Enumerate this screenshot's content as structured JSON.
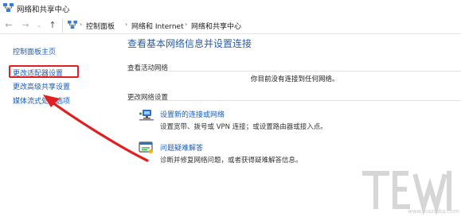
{
  "window": {
    "title": "网络和共享中心"
  },
  "nav": {
    "back_icon": "back-arrow-icon",
    "forward_icon": "forward-arrow-icon",
    "history_icon": "chevron-down-icon",
    "up_icon": "up-arrow-icon",
    "breadcrumbs": [
      "控制面板",
      "网络和 Internet",
      "网络和共享中心"
    ],
    "separator": "›"
  },
  "sidebar": {
    "items": [
      {
        "label": "控制面板主页"
      },
      {
        "label": "更改适配器设置",
        "highlighted": true
      },
      {
        "label": "更改高级共享设置"
      },
      {
        "label": "媒体流式处理选项"
      }
    ]
  },
  "main": {
    "heading": "查看基本网络信息并设置连接",
    "active_networks_label": "查看活动网络",
    "no_network_text": "你目前没有连接到任何网络。",
    "change_settings_label": "更改网络设置",
    "actions": [
      {
        "icon": "network-setup-icon",
        "title": "设置新的连接或网络",
        "description": "设置宽带、拨号或 VPN 连接；或设置路由器或接入点。"
      },
      {
        "icon": "troubleshoot-icon",
        "title": "问题疑难解答",
        "description": "诊断并修复网络问题，或者获得疑难解答信息。"
      }
    ]
  },
  "annotation": {
    "color": "#e02020"
  },
  "watermark": {
    "url": "www.xiazaiba.com"
  },
  "colors": {
    "link": "#1a5cb8",
    "heading": "#2a5ea8",
    "annotation": "#e02020"
  }
}
